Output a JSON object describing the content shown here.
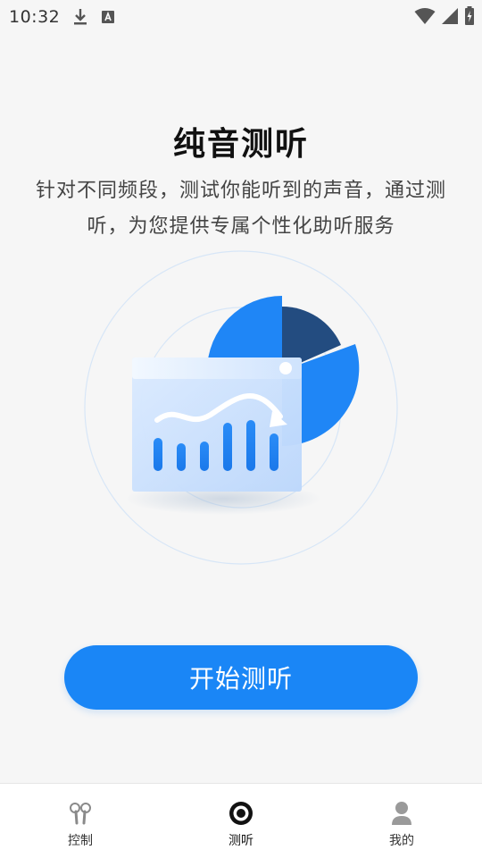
{
  "status_bar": {
    "time": "10:32",
    "icons_left": [
      "download-icon",
      "keyboard-a-icon"
    ],
    "icons_right": [
      "wifi-icon",
      "signal-icon",
      "battery-charging-icon"
    ]
  },
  "main": {
    "title": "纯音测听",
    "description": "针对不同频段，测试你能听到的声音，通过测听，为您提供专属个性化助听服务",
    "start_button_label": "开始测听"
  },
  "bottom_nav": {
    "items": [
      {
        "label": "控制",
        "icon": "earbuds-icon",
        "active": false
      },
      {
        "label": "测听",
        "icon": "target-icon",
        "active": true
      },
      {
        "label": "我的",
        "icon": "person-icon",
        "active": false
      }
    ]
  },
  "colors": {
    "accent": "#1a86f6",
    "pie_dark": "#234c80",
    "background": "#f6f6f6"
  }
}
